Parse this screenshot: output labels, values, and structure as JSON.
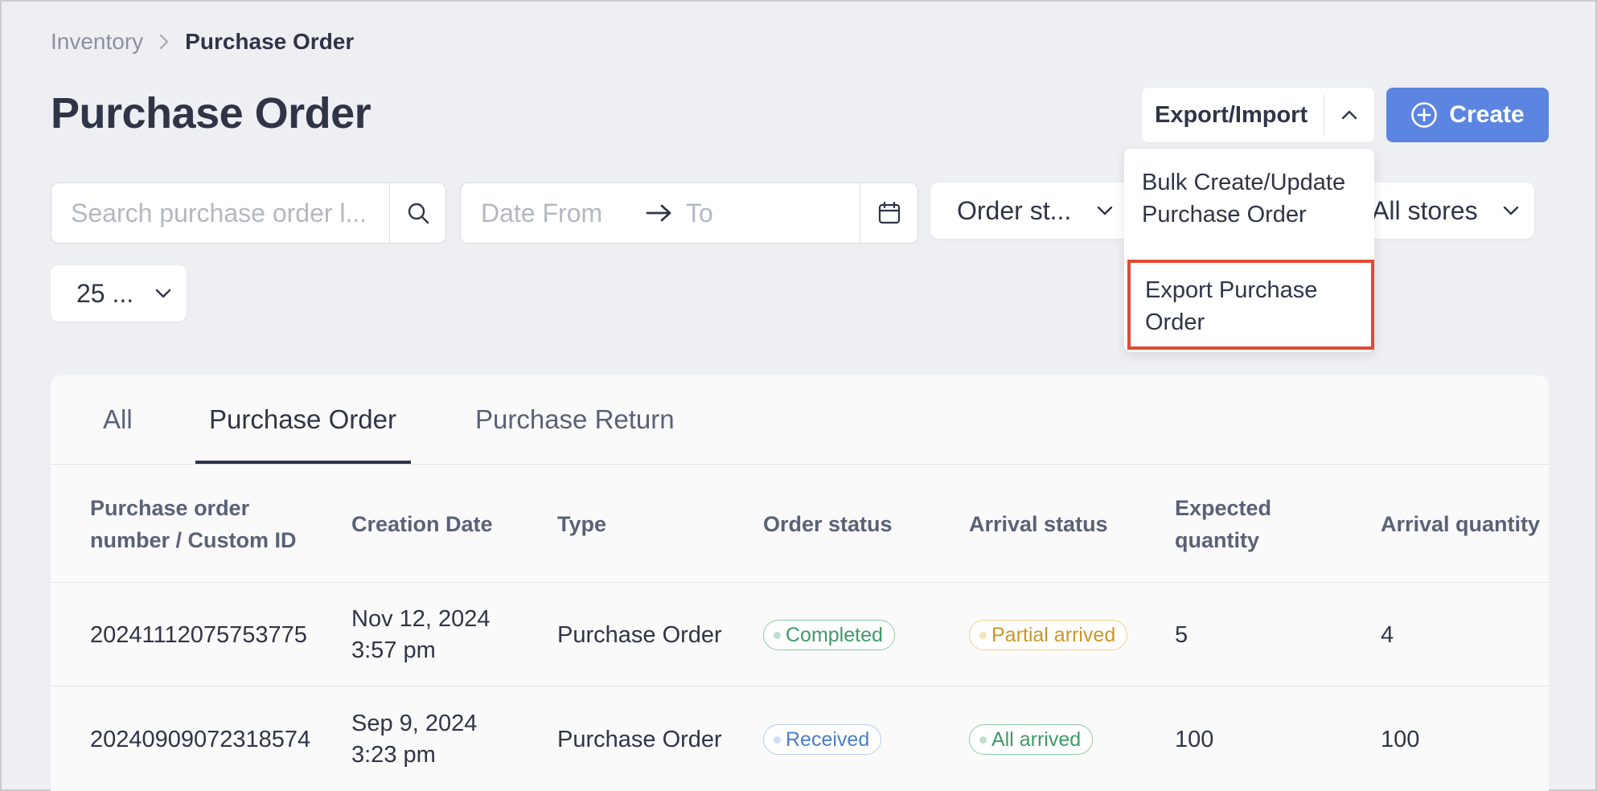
{
  "breadcrumb": {
    "parent": "Inventory",
    "current": "Purchase Order"
  },
  "page_title": "Purchase Order",
  "toolbar": {
    "export_import_label": "Export/Import",
    "create_label": "Create"
  },
  "export_menu": {
    "items": [
      "Bulk Create/Update Purchase Order",
      "Export Purchase Order"
    ],
    "highlighted_index": 1
  },
  "filters": {
    "search_placeholder": "Search purchase order l...",
    "date_from_placeholder": "Date From",
    "date_to_placeholder": "To",
    "order_status_value": "Order st...",
    "stores_value": "All stores",
    "page_size_value": "25 ..."
  },
  "tabs": [
    {
      "label": "All",
      "active": false
    },
    {
      "label": "Purchase Order",
      "active": true
    },
    {
      "label": "Purchase Return",
      "active": false
    }
  ],
  "table": {
    "columns": [
      "Purchase order number / Custom ID",
      "Creation Date",
      "Type",
      "Order status",
      "Arrival status",
      "Expected quantity",
      "Arrival quantity"
    ],
    "rows": [
      {
        "number": "20241112075753775",
        "date": "Nov 12, 2024",
        "time": "3:57 pm",
        "type": "Purchase Order",
        "order_status": "Completed",
        "arrival_status": "Partial arrived",
        "expected_qty": "5",
        "arrival_qty": "4"
      },
      {
        "number": "20240909072318574",
        "date": "Sep 9, 2024",
        "time": "3:23 pm",
        "type": "Purchase Order",
        "order_status": "Received",
        "arrival_status": "All arrived",
        "expected_qty": "100",
        "arrival_qty": "100"
      }
    ]
  },
  "colors": {
    "primary": "#5b85e0",
    "highlight_border": "#e04a35",
    "status_green": "#3e9a67",
    "status_orange": "#cf9620",
    "status_blue": "#4a7ec9"
  },
  "icons": [
    "chevron-right-icon",
    "chevron-up-icon",
    "plus-circle-icon",
    "search-icon",
    "arrow-right-icon",
    "calendar-icon",
    "chevron-down-icon"
  ]
}
